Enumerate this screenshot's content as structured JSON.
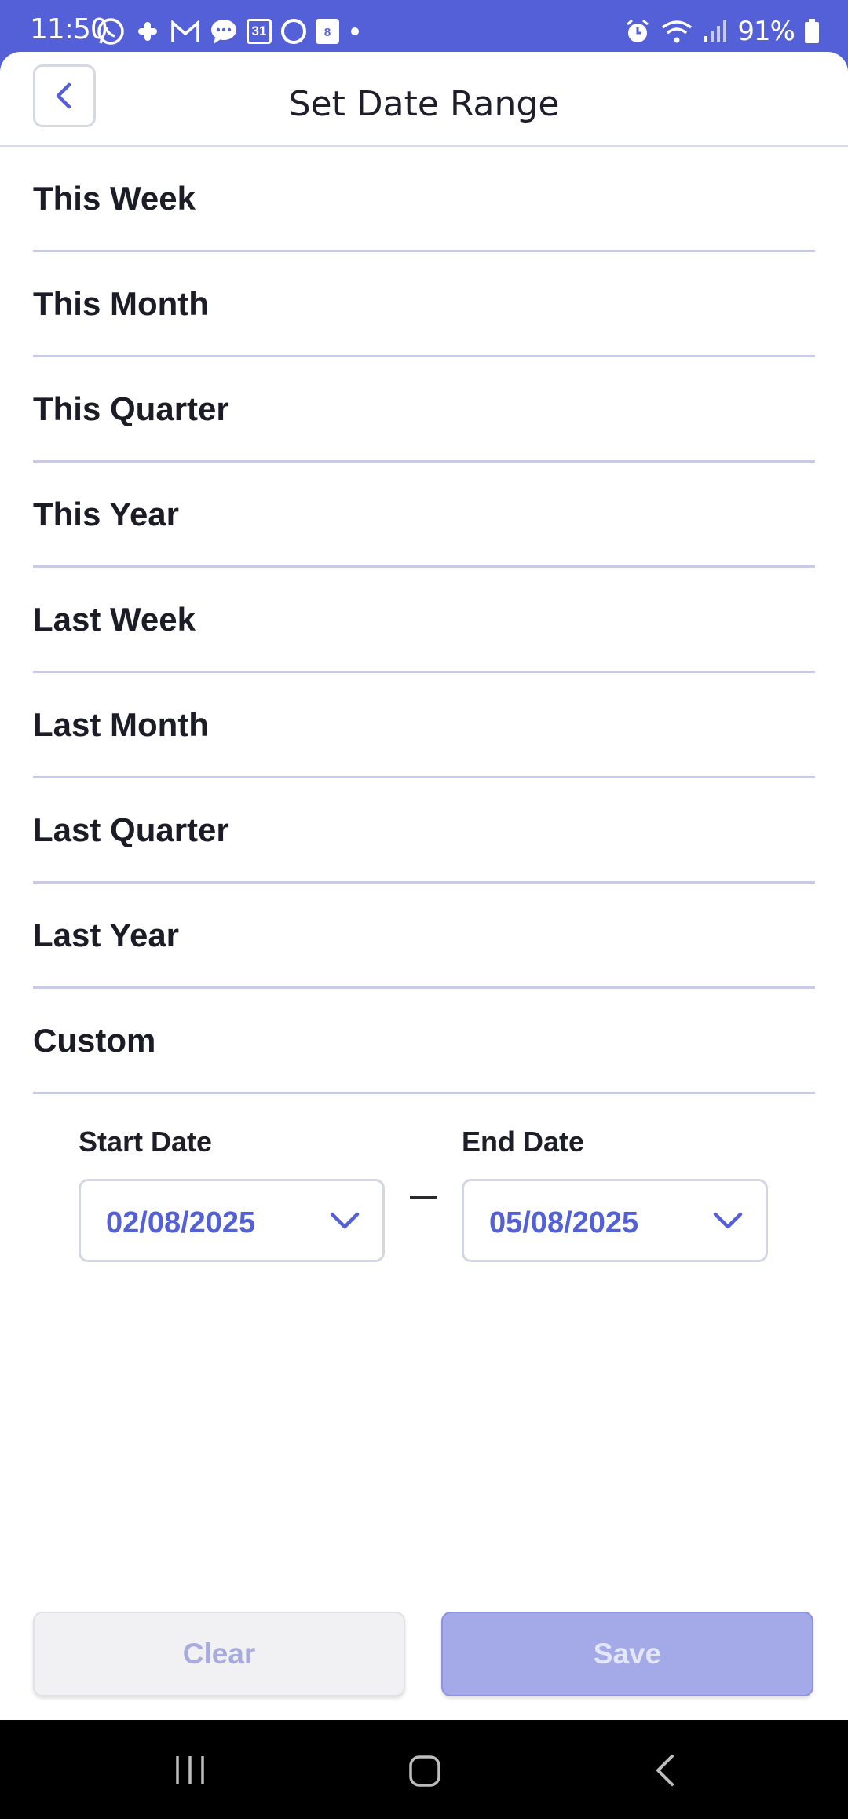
{
  "status_bar": {
    "time": "11:50",
    "battery": "91%",
    "left_icons": [
      "whatsapp-icon",
      "slack-icon",
      "gmail-icon",
      "messages-icon",
      "calendar-icon",
      "circle-app-icon",
      "calendar-small-icon",
      "dot-icon"
    ],
    "calendar_day": "31",
    "small_calendar_day": "8",
    "right_icons": [
      "alarm-icon",
      "wifi-icon",
      "signal-icon",
      "battery-icon"
    ]
  },
  "header": {
    "title": "Set Date Range",
    "back_icon": "chevron-left-icon"
  },
  "options": [
    {
      "label": "This Week"
    },
    {
      "label": "This Month"
    },
    {
      "label": "This Quarter"
    },
    {
      "label": "This Year"
    },
    {
      "label": "Last Week"
    },
    {
      "label": "Last Month"
    },
    {
      "label": "Last Quarter"
    },
    {
      "label": "Last Year"
    },
    {
      "label": "Custom"
    }
  ],
  "custom": {
    "start_label": "Start Date",
    "start_value": "02/08/2025",
    "end_label": "End Date",
    "end_value": "05/08/2025",
    "separator": "—"
  },
  "footer": {
    "clear_label": "Clear",
    "save_label": "Save"
  },
  "colors": {
    "accent": "#5460d8",
    "date_text": "#5360d6",
    "save_bg": "#a4a9e8",
    "clear_bg": "#f1f1f3"
  },
  "nav_bar": {
    "icons": [
      "recent-apps-icon",
      "home-icon",
      "back-icon"
    ]
  }
}
